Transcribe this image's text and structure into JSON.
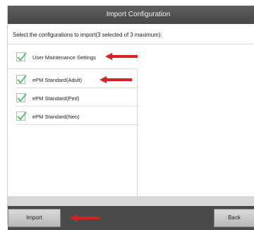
{
  "dialog": {
    "title": "Import Configuration",
    "instruction": "Select the configurations to import(3 selected of 3 maximum):"
  },
  "options": [
    {
      "label": "User Maintenance Settings",
      "checked": true
    },
    {
      "label": "ePM Standard(Adult)",
      "checked": true
    },
    {
      "label": "ePM Standard(Ped)",
      "checked": true
    },
    {
      "label": "ePM Standard(Neo)",
      "checked": true
    }
  ],
  "footer": {
    "import_label": "Import",
    "back_label": "Back"
  },
  "colors": {
    "check": "#3fbf5a",
    "annotation_arrow": "#d62222",
    "titlebar": "#505050"
  }
}
